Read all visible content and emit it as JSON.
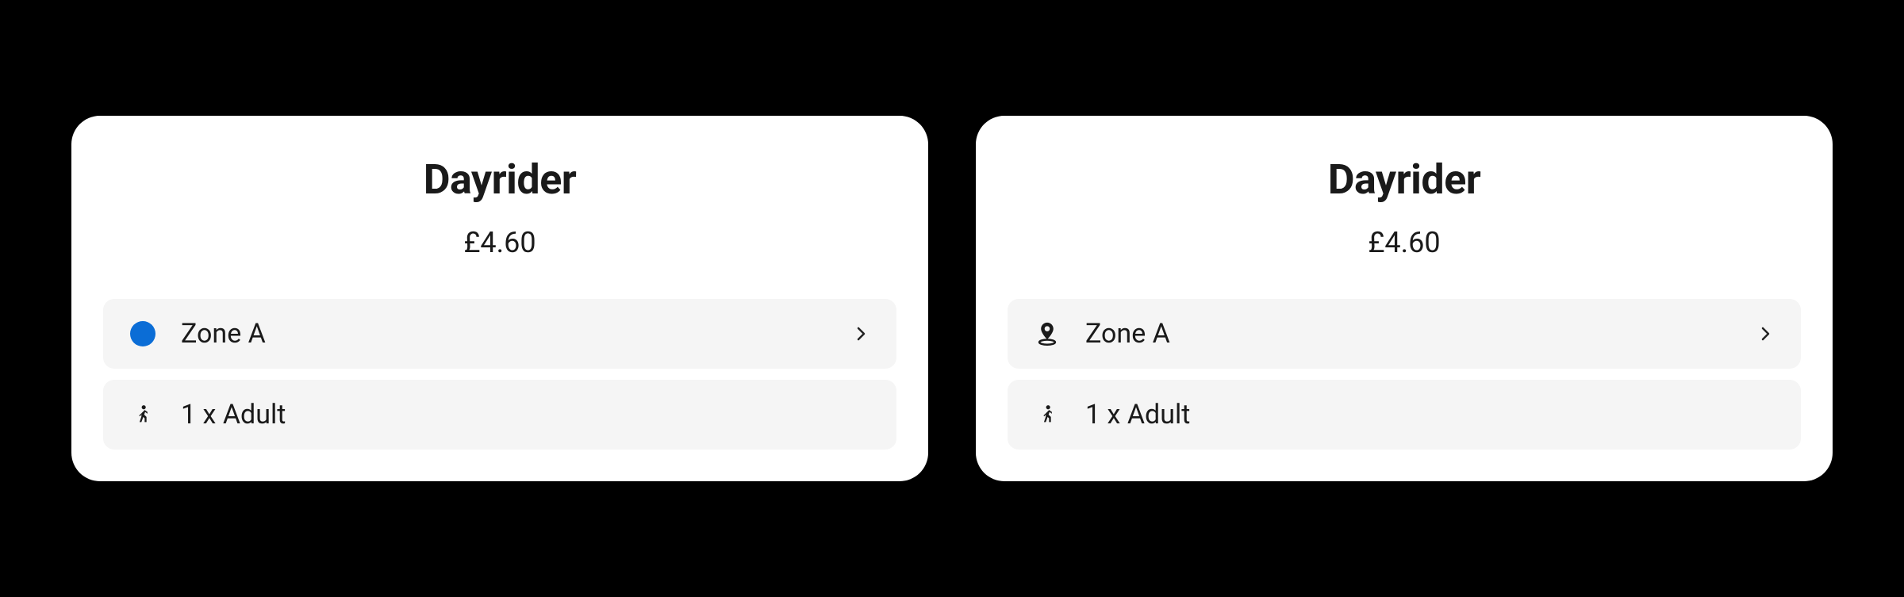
{
  "cards": [
    {
      "title": "Dayrider",
      "price": "£4.60",
      "rows": [
        {
          "icon": "zone-dot-icon",
          "label": "Zone A",
          "chevron": true
        },
        {
          "icon": "person-walking-icon",
          "label": "1 x Adult",
          "chevron": false
        }
      ]
    },
    {
      "title": "Dayrider",
      "price": "£4.60",
      "rows": [
        {
          "icon": "location-pin-icon",
          "label": "Zone A",
          "chevron": true
        },
        {
          "icon": "person-walking-icon",
          "label": "1 x Adult",
          "chevron": false
        }
      ]
    }
  ]
}
